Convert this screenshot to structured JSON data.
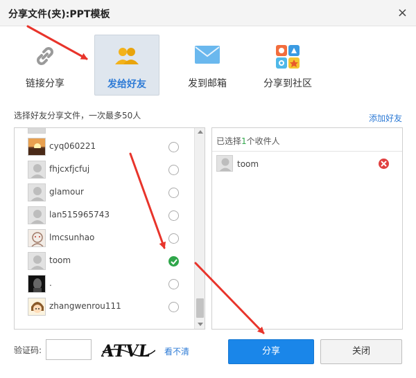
{
  "window": {
    "title": "分享文件(夹):PPT模板",
    "close_glyph": "×"
  },
  "tabs": [
    {
      "label": "链接分享",
      "icon": "link-icon",
      "active": false
    },
    {
      "label": "发给好友",
      "icon": "friends-icon",
      "active": true
    },
    {
      "label": "发到邮箱",
      "icon": "mail-icon",
      "active": false
    },
    {
      "label": "分享到社区",
      "icon": "community-icon",
      "active": false
    }
  ],
  "friends_section": {
    "hint": "选择好友分享文件，一次最多50人",
    "add_friend": "添加好友",
    "friends": [
      {
        "name": "cyq060221",
        "checked": false,
        "avatar": "sunset-photo"
      },
      {
        "name": "fhjcxfjcfuj",
        "checked": false,
        "avatar": "default-avatar"
      },
      {
        "name": "glamour",
        "checked": false,
        "avatar": "default-avatar"
      },
      {
        "name": "lan515965743",
        "checked": false,
        "avatar": "default-avatar"
      },
      {
        "name": "lmcsunhao",
        "checked": false,
        "avatar": "sketch-photo"
      },
      {
        "name": "toom",
        "checked": true,
        "avatar": "default-avatar"
      },
      {
        "name": ".",
        "checked": false,
        "avatar": "dark-photo"
      },
      {
        "name": "zhangwenrou111",
        "checked": false,
        "avatar": "cartoon-girl"
      }
    ]
  },
  "selected": {
    "prefix": "已选择",
    "count": "1",
    "suffix": "个收件人",
    "recipients": [
      {
        "name": "toom"
      }
    ]
  },
  "footer": {
    "vcode_label": "验证码:",
    "vcode_value": "",
    "captcha_text": "ATVL",
    "refresh_label": "看不清",
    "share_button": "分享",
    "close_button": "关闭"
  },
  "colors": {
    "accent": "#1a86e9",
    "check_green": "#2fa64a",
    "remove_red": "#e04040",
    "annotation_red": "#e8342b"
  }
}
